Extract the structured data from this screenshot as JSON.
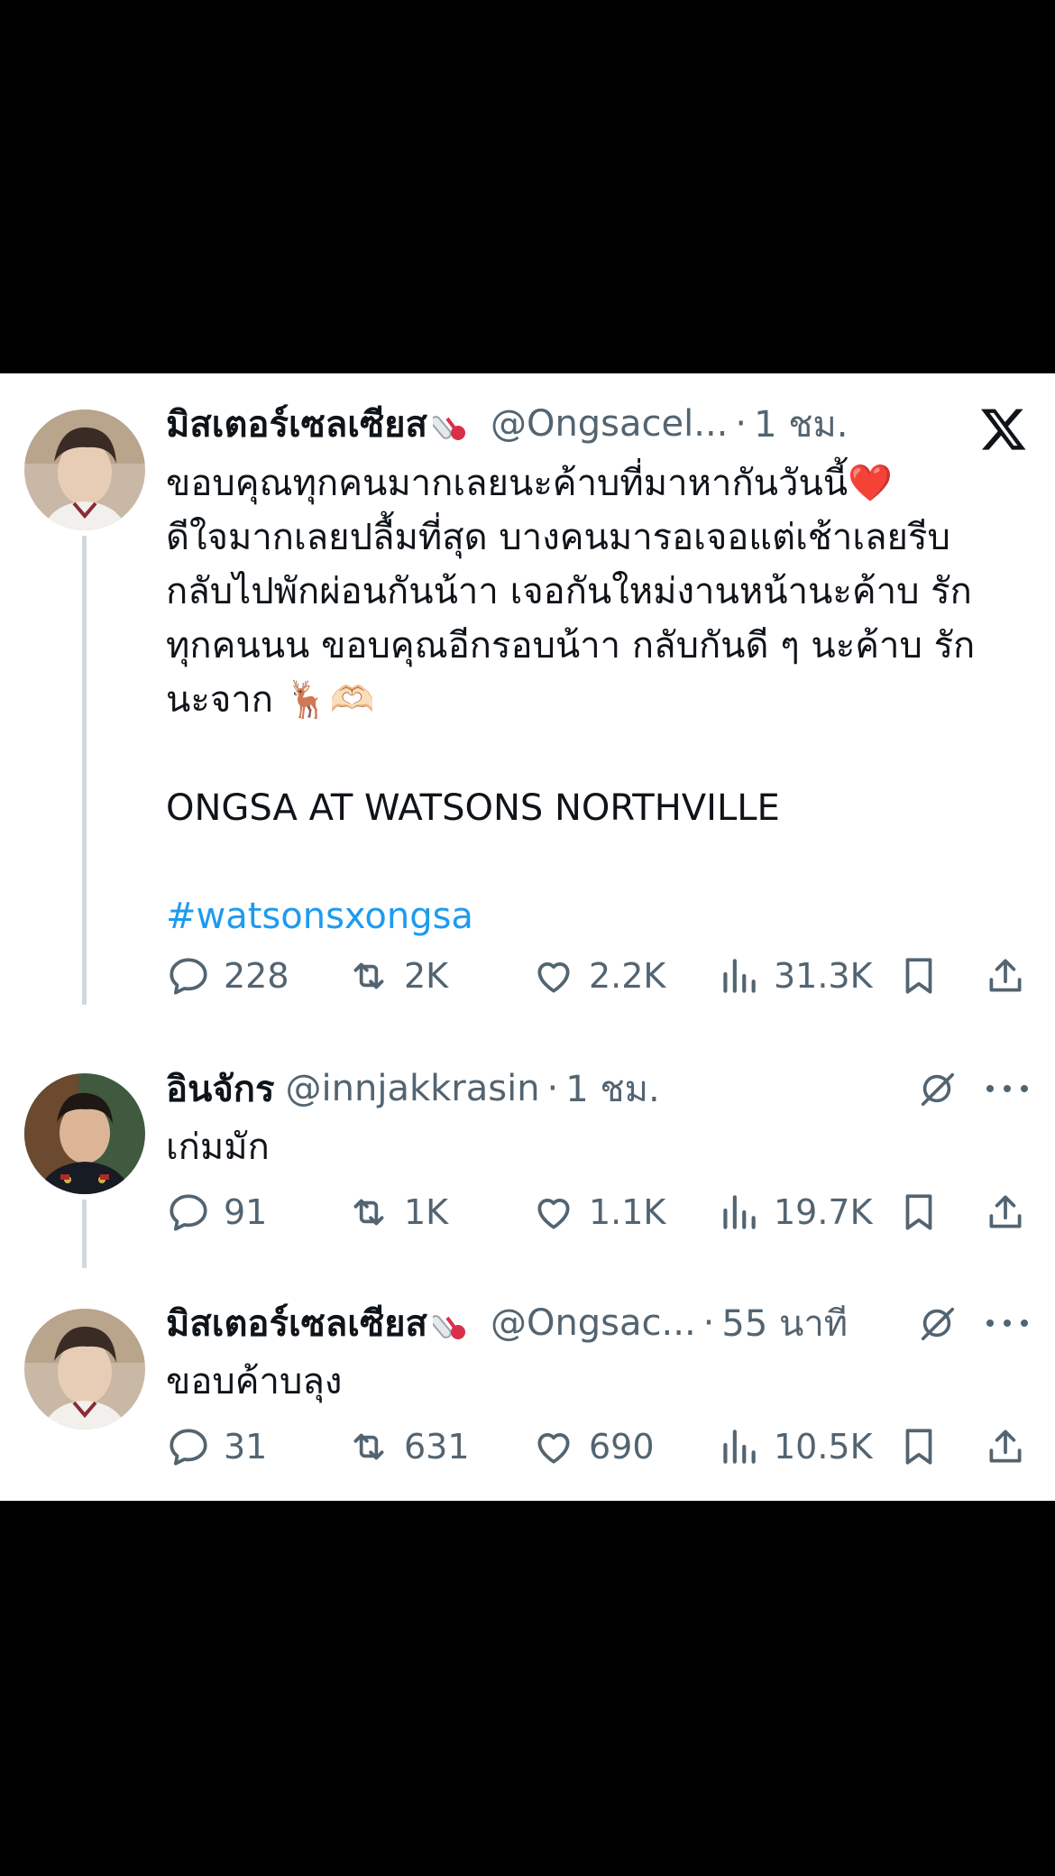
{
  "tweets": [
    {
      "name": "มิสเตอร์เซลเซียส",
      "handle": "@Ongsacel...",
      "time": "1 ชม.",
      "text_lines": [
        "ขอบคุณทุกคนมากเลยนะค้าบที่มาหากันวันนี้❤️",
        "ดีใจมากเลยปลื้มที่สุด บางคนมารอเจอแต่เช้าเลยรีบ",
        "กลับไปพักผ่อนกันน้าา เจอกันใหม่งานหน้านะค้าบ รัก",
        "ทุกคนนน ขอบคุณอีกรอบน้าา กลับกันดี ๆ นะค้าบ รัก",
        "นะจาก 🦌🫶🏻"
      ],
      "caption": "ONGSA AT WATSONS NORTHVILLE",
      "hashtag": "#watsonsxongsa",
      "replies": "228",
      "reposts": "2K",
      "likes": "2.2K",
      "views": "31.3K"
    },
    {
      "name": "อินจักร",
      "handle": "@innjakkrasin",
      "time": "1 ชม.",
      "text": "เก่มมัก",
      "replies": "91",
      "reposts": "1K",
      "likes": "1.1K",
      "views": "19.7K"
    },
    {
      "name": "มิสเตอร์เซลเซียส",
      "handle": "@Ongsac...",
      "time": "55 นาที",
      "text": "ขอบค้าบลุง",
      "replies": "31",
      "reposts": "631",
      "likes": "690",
      "views": "10.5K"
    }
  ],
  "colors": {
    "accent": "#1d9bf0",
    "secondary_text": "#536471",
    "thread_line": "#cfd9de"
  },
  "icons": [
    "x-logo-icon",
    "reply-icon",
    "repost-icon",
    "like-icon",
    "views-icon",
    "bookmark-icon",
    "share-icon",
    "grok-icon",
    "more-icon",
    "thermometer-icon"
  ]
}
